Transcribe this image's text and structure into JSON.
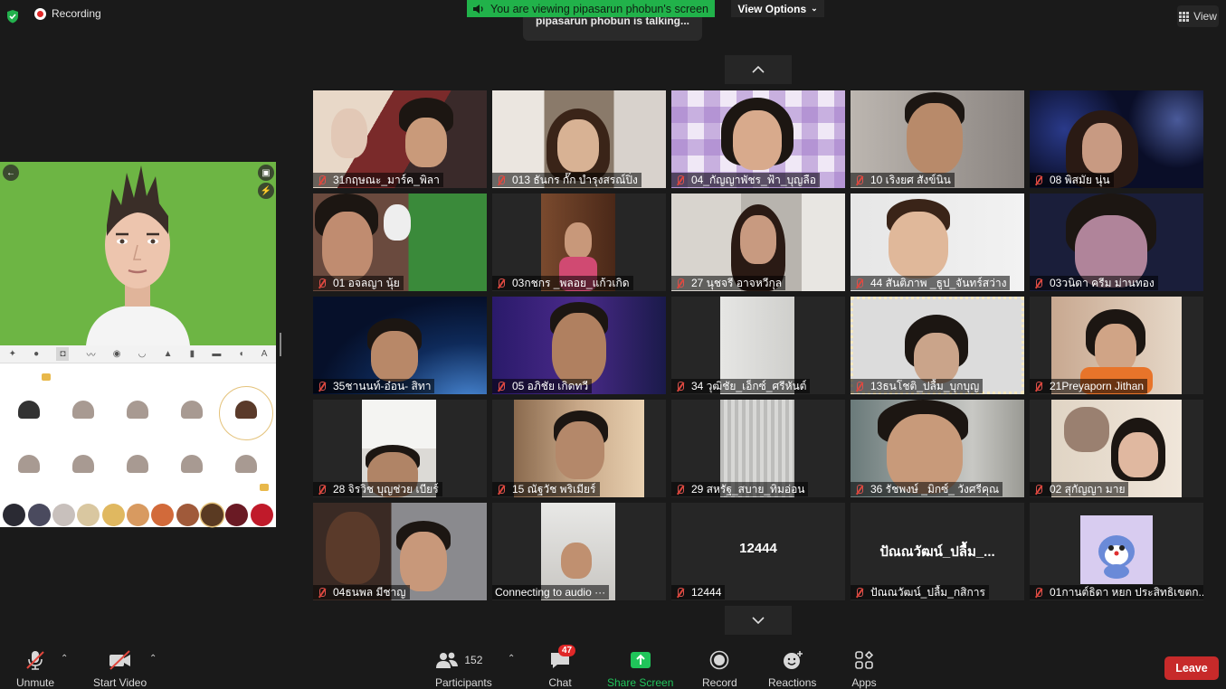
{
  "topbar": {
    "recording_label": "Recording",
    "viewing_banner": "You are viewing pipasarun phobun's screen",
    "view_options": "View Options",
    "talking": "pipasarun phobun is talking...",
    "view_label": "View"
  },
  "tiles": [
    {
      "name": "31กฤษณะ_มาร์ค_พิลา",
      "muted": true
    },
    {
      "name": "013 ธันกร กั๊ก บำรุงสรณ์ปิ่ง",
      "muted": true
    },
    {
      "name": "04_กัญญาพัชร_ฟ้า_บุญลือ",
      "muted": true
    },
    {
      "name": "10 เริงยศ สังข์นิน",
      "muted": true
    },
    {
      "name": "08 พิสมัย นุ่น",
      "muted": true
    },
    {
      "name": "01 อจลญา นุ้ย",
      "muted": true
    },
    {
      "name": "03กชกร _พลอย_แก้วเกิด",
      "muted": true
    },
    {
      "name": "27 นุชจรี อาจหวีกุล",
      "muted": true
    },
    {
      "name": "44 สันติภาพ _ธูป_จันทร์สว่าง",
      "muted": true
    },
    {
      "name": "03วนิดา  ครีม   ม่านทอง",
      "muted": true
    },
    {
      "name": "35ชานนท์-อ๋อน- สิทา",
      "muted": true
    },
    {
      "name": "05 อภิชัย เกิดทวี",
      "muted": true
    },
    {
      "name": "34 วุฒิชัย_เอ็กซ์_ศรีหันต์",
      "muted": true
    },
    {
      "name": "13ธนโชติ_ปลื้ม_บุกบุญ",
      "muted": true
    },
    {
      "name": "21Preyaporn Jithan",
      "muted": true
    },
    {
      "name": "28 จิรวิช บุญช่วย เบียร์",
      "muted": true
    },
    {
      "name": "15 ณัฐวัช พริเมียร์",
      "muted": true
    },
    {
      "name": "29 สหรัฐ_สบาย_ทิมอ่อน",
      "muted": true
    },
    {
      "name": "36 รัชพงษ์ _มิกซ์_ วังศรีคุณ",
      "muted": true
    },
    {
      "name": "02 สุกัญญา มาย",
      "muted": true
    },
    {
      "name": "04ธนพล มีชาญ",
      "muted": true
    },
    {
      "name": "Connecting to audio ···",
      "muted": false
    },
    {
      "name": "12444",
      "muted": true,
      "big_label": "12444"
    },
    {
      "name": "ปัณณวัฒน์_ปลื้ม_กสิการ",
      "muted": true,
      "big_label": "ปัณณวัฒน์_ปลื้ม_..."
    },
    {
      "name": "01กานต์ธิดา หยก ประสิทธิเขตก...",
      "muted": true
    }
  ],
  "toolbar": {
    "unmute": "Unmute",
    "start_video": "Start Video",
    "participants": "Participants",
    "participants_count": "152",
    "chat": "Chat",
    "chat_badge": "47",
    "share_screen": "Share Screen",
    "record": "Record",
    "reactions": "Reactions",
    "apps": "Apps",
    "leave": "Leave"
  },
  "avatar_tools": [
    "✦",
    "●",
    "◘",
    "〰",
    "◉",
    "◡",
    "▲",
    "▮",
    "▬",
    "◖",
    "A"
  ],
  "colors": {
    "accent_green": "#21b24a",
    "leave_red": "#c72a2a",
    "badge_red": "#e02828",
    "avatar_bg": "#6db544"
  }
}
